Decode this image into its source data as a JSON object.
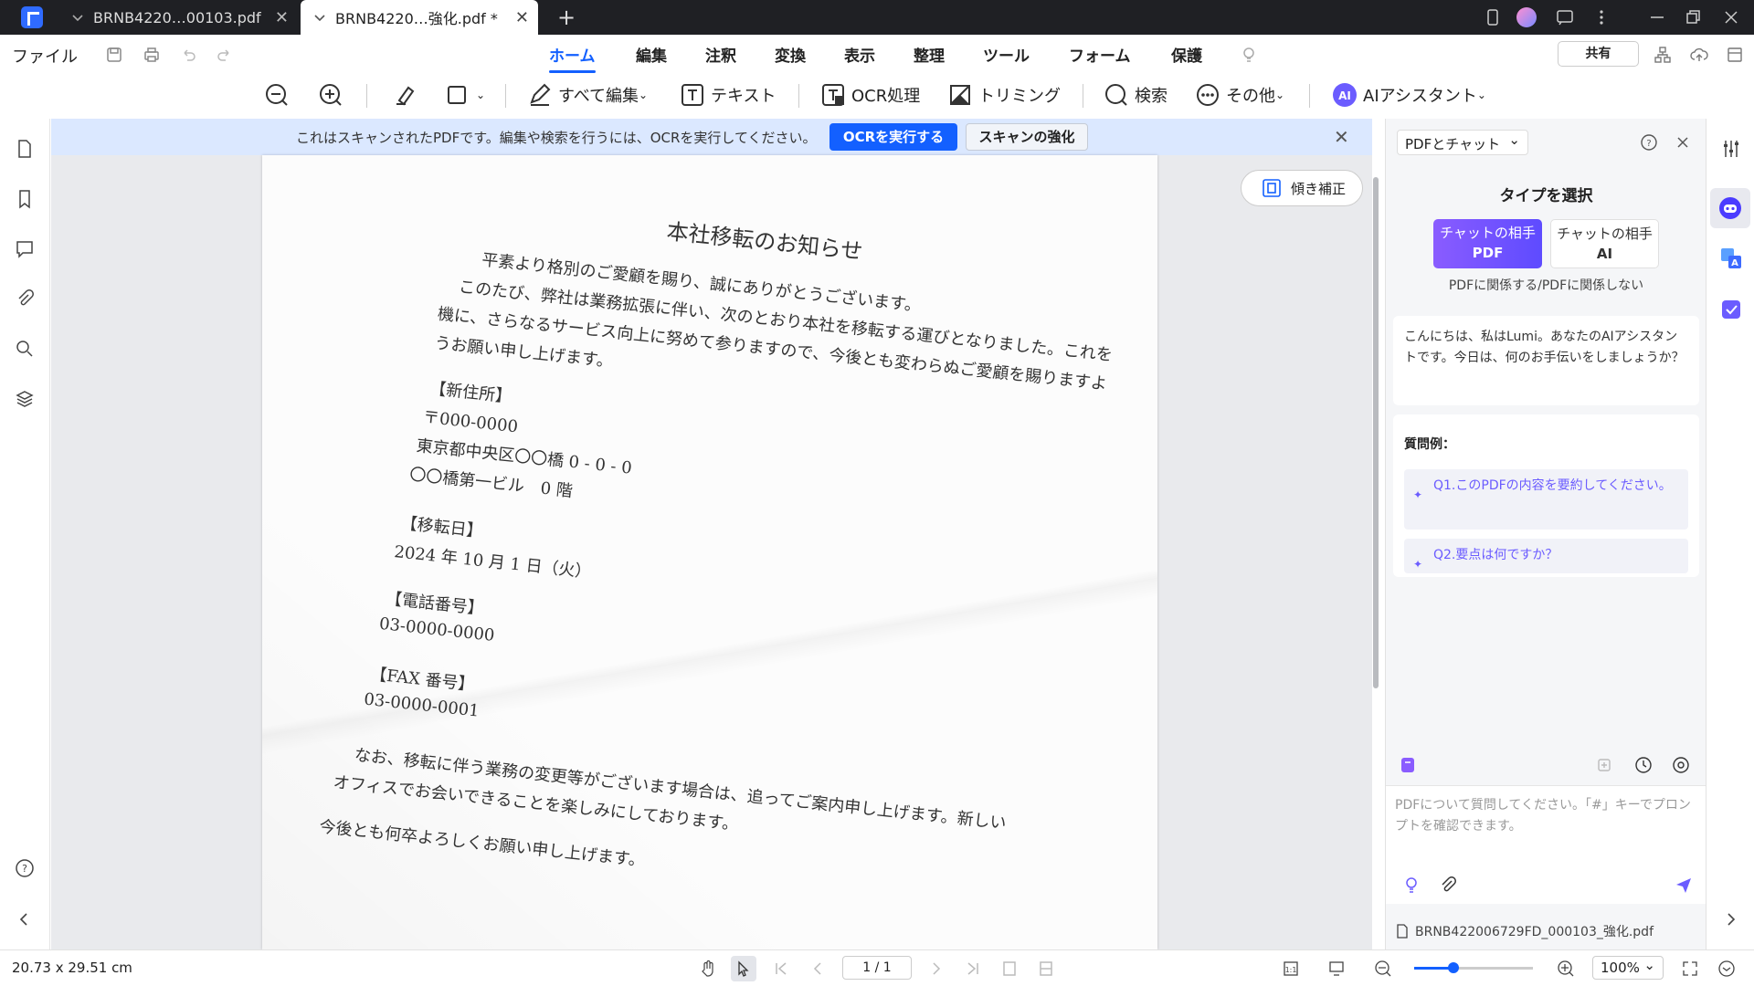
{
  "titlebar": {
    "tabs": [
      {
        "label": "BRNB4220…00103.pdf"
      },
      {
        "label": "BRNB4220…強化.pdf *"
      }
    ],
    "new_tab": "+"
  },
  "menubar": {
    "file_label": "ファイル",
    "menus": [
      "ホーム",
      "編集",
      "注釈",
      "変換",
      "表示",
      "整理",
      "ツール",
      "フォーム",
      "保護"
    ],
    "share_label": "共有"
  },
  "toolbar": {
    "edit_all": "すべて編集",
    "text": "テキスト",
    "ocr": "OCR処理",
    "trim": "トリミング",
    "search": "検索",
    "more": "その他",
    "ai": "AIアシスタント"
  },
  "banner": {
    "message": "これはスキャンされたPDFです。編集や検索を行うには、OCRを実行してください。",
    "ocr_button": "OCRを実行する",
    "enhance_button": "スキャンの強化"
  },
  "deskew_label": "傾き補正",
  "document": {
    "title": "本社移転のお知らせ",
    "lines": [
      "平素より格別のご愛顧を賜り、誠にありがとうございます。",
      "このたび、弊社は業務拡張に伴い、次のとおり本社を移転する運びとなりました。これを",
      "機に、さらなるサービス向上に努めて参りますので、今後とも変わらぬご愛顧を賜りますよ",
      "うお願い申し上げます。",
      "【新住所】",
      "〒000-0000",
      "東京都中央区〇〇橋 0 - 0 - 0",
      "〇〇橋第一ビル　0 階",
      "【移転日】",
      "2024 年 10 月 1 日（火）",
      "【電話番号】",
      "03-0000-0000",
      "【FAX 番号】",
      "03-0000-0001",
      "なお、移転に伴う業務の変更等がございます場合は、追ってご案内申し上げます。新しい",
      "オフィスでお会いできることを楽しみにしております。",
      "今後とも何卒よろしくお願い申し上げます。"
    ]
  },
  "chat": {
    "selector": "PDFとチャット",
    "type_heading": "タイプを選択",
    "type1_line1": "チャットの相手",
    "type1_line2": "PDF",
    "type2_line1": "チャットの相手",
    "type2_line2": "AI",
    "type_sub": "PDFに関係する/PDFに関係しない",
    "greeting": "こんにちは、私はLumi。あなたのAIアシスタントです。今日は、何のお手伝いをしましょうか？",
    "examples_label": "質問例：",
    "q1": "Q1.このPDFの内容を要約してください。",
    "q2": "Q2.要点は何ですか？",
    "input_placeholder": "PDFについて質問してください。「#」キーでプロンプトを確認できます。",
    "file_name": "BRNB422006729FD_000103_強化.pdf"
  },
  "status": {
    "dimensions": "20.73 x 29.51 cm",
    "page": "1 / 1",
    "zoom": "100%",
    "zoom_fraction": 0.33
  },
  "colors": {
    "accent": "#1360ff",
    "ai_purple": "#6b5cff",
    "titlebar": "#1f2024"
  }
}
